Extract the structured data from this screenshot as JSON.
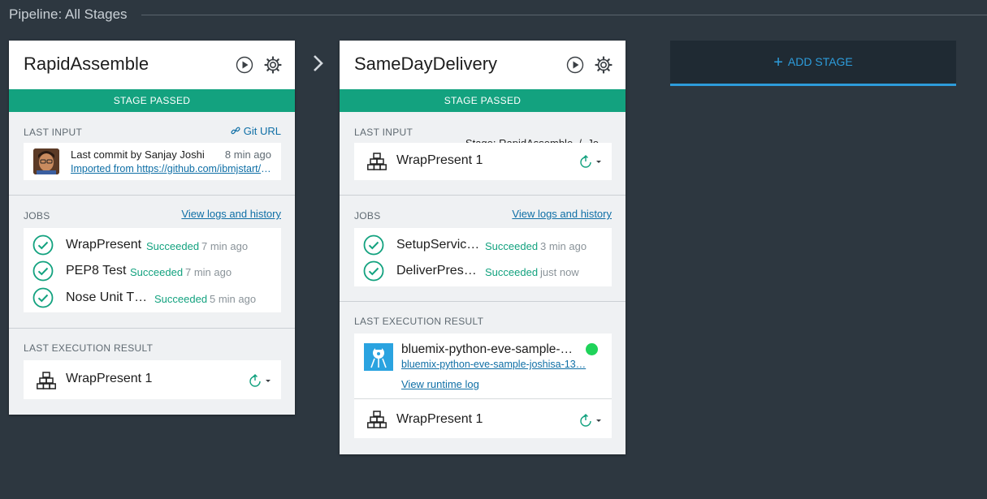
{
  "header": {
    "title": "Pipeline: All Stages"
  },
  "stages": [
    {
      "name": "RapidAssemble",
      "status": "STAGE PASSED",
      "last_input": {
        "label": "LAST INPUT",
        "link": "Git URL",
        "commit_prefix": "Last commit by ",
        "commit_author": "Sanjay Joshi",
        "commit_time": "8 min ago",
        "commit_message": "Imported from https://github.com/ibmjstart/bluemix-python-eve-sample"
      },
      "jobs": {
        "label": "JOBS",
        "link": "View logs and history",
        "items": [
          {
            "name": "WrapPresent",
            "status": "Succeeded",
            "time": "7 min ago"
          },
          {
            "name": "PEP8 Test",
            "status": "Succeeded",
            "time": "7 min ago"
          },
          {
            "name": "Nose Unit T…",
            "status": "Succeeded",
            "time": "5 min ago"
          }
        ]
      },
      "last_execution": {
        "label": "LAST EXECUTION RESULT",
        "build": "WrapPresent 1"
      }
    },
    {
      "name": "SameDayDelivery",
      "status": "STAGE PASSED",
      "last_input": {
        "label": "LAST INPUT",
        "source_prefix": "Stage: ",
        "source_stage": "RapidAssemble",
        "source_sep": "/",
        "source_job": "Jo…",
        "build": "WrapPresent 1"
      },
      "jobs": {
        "label": "JOBS",
        "link": "View logs and history",
        "items": [
          {
            "name": "SetupServic…",
            "status": "Succeeded",
            "time": "3 min ago"
          },
          {
            "name": "DeliverPres…",
            "status": "Succeeded",
            "time": "just now"
          }
        ]
      },
      "last_execution": {
        "label": "LAST EXECUTION RESULT",
        "app_name": "bluemix-python-eve-sample-…",
        "app_url": "bluemix-python-eve-sample-joshisa-13…",
        "runtime_log": "View runtime log",
        "build": "WrapPresent 1",
        "app_status_color": "#1fd35a"
      }
    }
  ],
  "add_stage": {
    "label": "ADD STAGE"
  },
  "colors": {
    "accent": "#13a27f",
    "link": "#0f6fa6",
    "add_stage": "#2d9cdb",
    "background": "#2d3740"
  }
}
